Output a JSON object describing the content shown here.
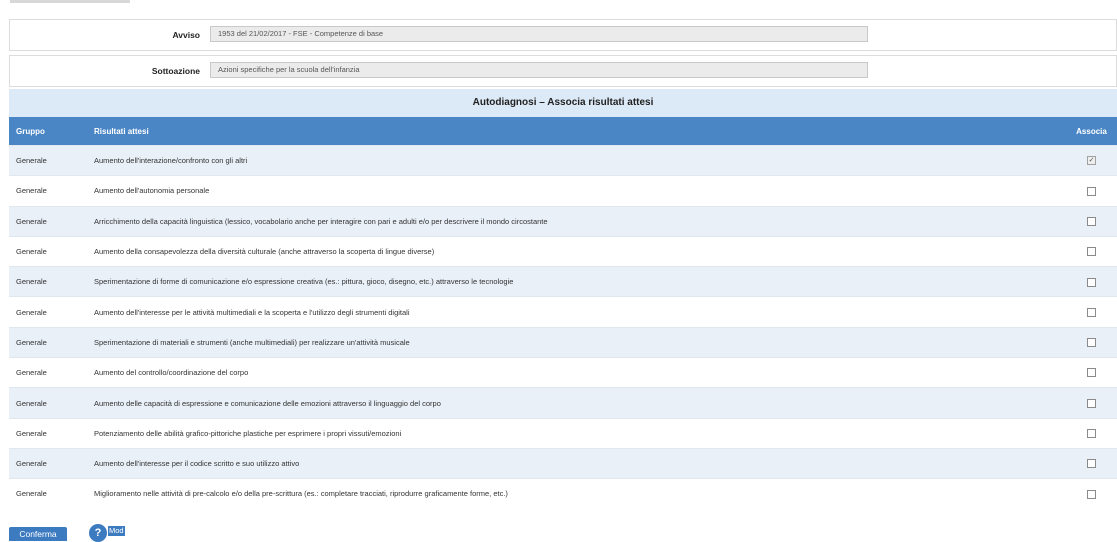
{
  "form": {
    "avviso_label": "Avviso",
    "avviso_value": "1953 del 21/02/2017 - FSE - Competenze di base",
    "sottoazione_label": "Sottoazione",
    "sottoazione_value": "Azioni specifiche per la scuola dell'infanzia"
  },
  "table": {
    "caption": "Autodiagnosi – Associa risultati attesi",
    "headers": [
      "Gruppo",
      "Risultati attesi",
      "Associa"
    ],
    "rows": [
      {
        "gruppo": "Generale",
        "risultato": "Aumento dell'interazione/confronto con gli altri",
        "associa": true
      },
      {
        "gruppo": "Generale",
        "risultato": "Aumento dell'autonomia personale",
        "associa": false
      },
      {
        "gruppo": "Generale",
        "risultato": "Arricchimento della capacità linguistica (lessico, vocabolario anche per interagire con pari e adulti e/o per descrivere il mondo circostante",
        "associa": false
      },
      {
        "gruppo": "Generale",
        "risultato": "Aumento della consapevolezza della diversità culturale (anche attraverso la scoperta di lingue diverse)",
        "associa": false
      },
      {
        "gruppo": "Generale",
        "risultato": "Sperimentazione di forme di comunicazione e/o espressione creativa (es.: pittura, gioco, disegno, etc.) attraverso le tecnologie",
        "associa": false
      },
      {
        "gruppo": "Generale",
        "risultato": "Aumento dell'interesse per le attività multimediali e la scoperta e l'utilizzo degli strumenti digitali",
        "associa": false
      },
      {
        "gruppo": "Generale",
        "risultato": "Sperimentazione di materiali e strumenti (anche multimediali) per realizzare un'attività musicale",
        "associa": false
      },
      {
        "gruppo": "Generale",
        "risultato": "Aumento del controllo/coordinazione del corpo",
        "associa": false
      },
      {
        "gruppo": "Generale",
        "risultato": "Aumento delle capacità di espressione e comunicazione delle emozioni attraverso il linguaggio del corpo",
        "associa": false
      },
      {
        "gruppo": "Generale",
        "risultato": "Potenziamento delle abilità grafico-pittoriche plastiche per esprimere i propri vissuti/emozioni",
        "associa": false
      },
      {
        "gruppo": "Generale",
        "risultato": "Aumento dell'interesse per il codice scritto e suo utilizzo attivo",
        "associa": false
      },
      {
        "gruppo": "Generale",
        "risultato": "Miglioramento nelle attività di pre-calcolo e/o della pre-scrittura (es.: completare tracciati, riprodurre graficamente forme, etc.)",
        "associa": false
      }
    ]
  },
  "footer": {
    "confirm_label": "Conferma",
    "help_icon_glyph": "?",
    "help_label": "Mod"
  },
  "icons": {
    "help": "question-circle-icon",
    "checkbox": "checkbox-icon"
  },
  "colors": {
    "header_blue": "#4a86c5",
    "caption_bg": "#dce9f6",
    "row_alt": "#e9f0f8",
    "button_blue": "#3d7bc0"
  }
}
